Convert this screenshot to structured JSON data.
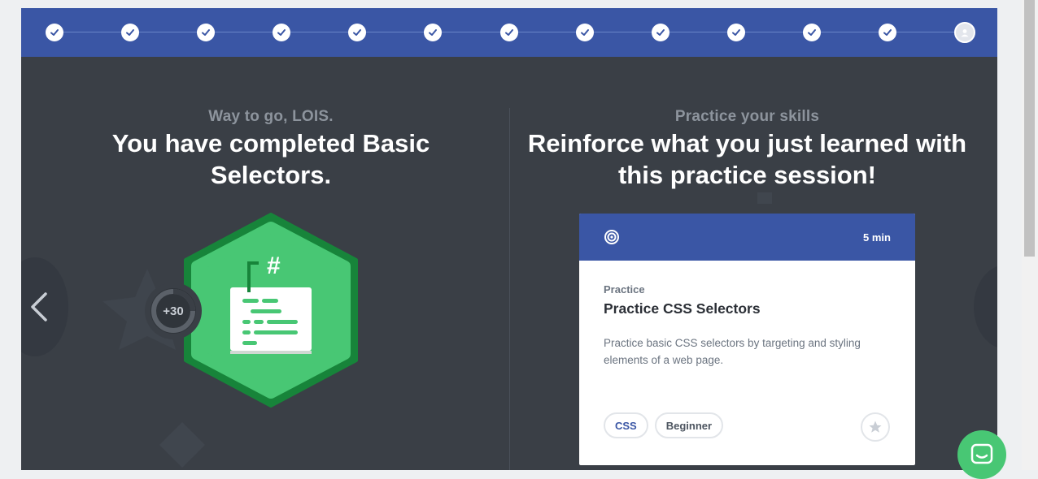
{
  "progress": {
    "completed_steps": 12,
    "total_steps": 13,
    "step_icon": "check-icon",
    "current_icon": "user-avatar-icon"
  },
  "left": {
    "eyebrow": "Way to go, LOIS.",
    "headline": "You have completed Basic Selectors.",
    "badge_icon": "code-hashtag-badge-icon",
    "xp_label": "+30",
    "prev_icon": "chevron-left-icon"
  },
  "right": {
    "eyebrow": "Practice your skills",
    "headline": "Reinforce what you just learned with this practice session!"
  },
  "card": {
    "icon": "target-icon",
    "duration": "5 min",
    "kicker": "Practice",
    "title": "Practice CSS Selectors",
    "description": "Practice basic CSS selectors by targeting and styling elements of a web page.",
    "tags": [
      "CSS",
      "Beginner"
    ],
    "star_icon": "star-icon"
  },
  "chat": {
    "icon": "chat-icon"
  },
  "colors": {
    "brand_blue": "#3a56a5",
    "dark_bg": "#3a3f46",
    "badge_green": "#48c774",
    "badge_dark_green": "#17843a"
  }
}
